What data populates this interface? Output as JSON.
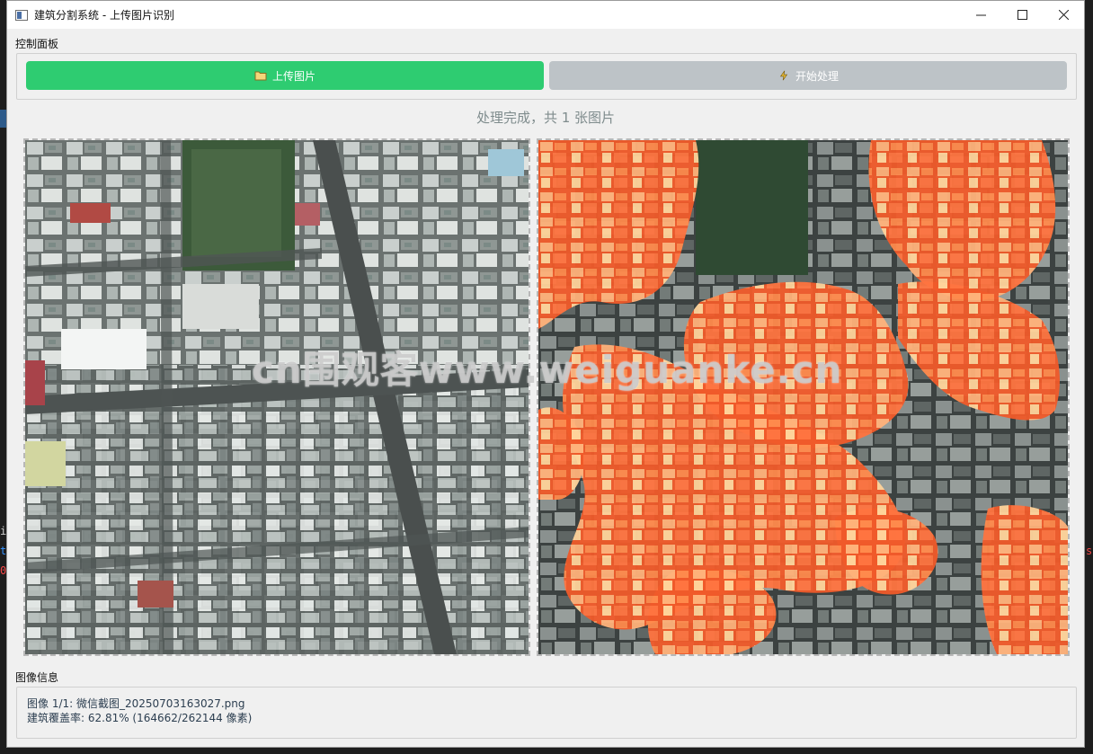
{
  "window": {
    "title": "建筑分割系统 - 上传图片识别",
    "minimize_glyph": "—",
    "maximize_glyph": "□",
    "close_glyph": "✕"
  },
  "control_panel": {
    "label": "控制面板",
    "upload_button": {
      "label": "上传图片",
      "icon": "folder-icon",
      "color": "#2ecc71"
    },
    "process_button": {
      "label": "开始处理",
      "icon": "lightning-icon",
      "color": "#bdc3c7"
    }
  },
  "status": {
    "text": "处理完成，共 1 张图片"
  },
  "images": {
    "original": {
      "icon": "aerial-photo-original"
    },
    "segmented": {
      "icon": "aerial-photo-segmentation-overlay",
      "overlay_color": "#ff5a28"
    }
  },
  "watermark": {
    "text": "cn围观客www.weiguanke.cn"
  },
  "image_info": {
    "label": "图像信息",
    "line1": "图像 1/1: 微信截图_20250703163027.png",
    "line2": "建筑覆盖率: 62.81% (164662/262144 像素)"
  },
  "background": {
    "strip_chars": [
      "i",
      "t",
      "0"
    ],
    "right_char": "s"
  }
}
